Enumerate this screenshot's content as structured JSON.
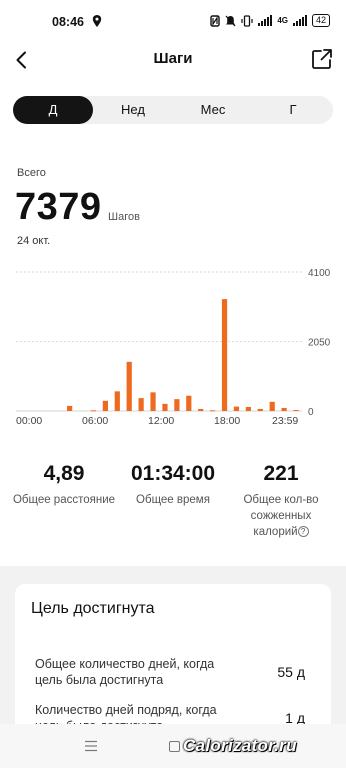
{
  "status": {
    "time": "08:46",
    "battery": "42",
    "network": "4G"
  },
  "header": {
    "title": "Шаги"
  },
  "tabs": [
    {
      "label": "Д",
      "active": true
    },
    {
      "label": "Нед",
      "active": false
    },
    {
      "label": "Мес",
      "active": false
    },
    {
      "label": "Г",
      "active": false
    }
  ],
  "summary": {
    "label": "Всего",
    "value": "7379",
    "unit": "Шагов",
    "date": "24 окт."
  },
  "chart_data": {
    "type": "bar",
    "color": "#ee6a1f",
    "x_tick_labels": [
      "00:00",
      "06:00",
      "12:00",
      "18:00",
      "23:59"
    ],
    "y_tick_labels": [
      "4100",
      "2050",
      "0"
    ],
    "ylim": [
      0,
      4100
    ],
    "bars": [
      {
        "hour": 4.5,
        "value": 150
      },
      {
        "hour": 6.5,
        "value": 20
      },
      {
        "hour": 7.5,
        "value": 300
      },
      {
        "hour": 8.5,
        "value": 580
      },
      {
        "hour": 9.5,
        "value": 1450
      },
      {
        "hour": 10.5,
        "value": 380
      },
      {
        "hour": 11.5,
        "value": 550
      },
      {
        "hour": 12.5,
        "value": 210
      },
      {
        "hour": 13.5,
        "value": 350
      },
      {
        "hour": 14.5,
        "value": 450
      },
      {
        "hour": 15.5,
        "value": 60
      },
      {
        "hour": 16.5,
        "value": 20
      },
      {
        "hour": 17.5,
        "value": 3300
      },
      {
        "hour": 18.5,
        "value": 130
      },
      {
        "hour": 19.5,
        "value": 120
      },
      {
        "hour": 20.5,
        "value": 60
      },
      {
        "hour": 21.5,
        "value": 270
      },
      {
        "hour": 22.5,
        "value": 90
      },
      {
        "hour": 23.5,
        "value": 30
      }
    ]
  },
  "stats": [
    {
      "value": "4,89",
      "label": "Общее расстояние"
    },
    {
      "value": "01:34:00",
      "label": "Общее время"
    },
    {
      "value": "221",
      "label_line1": "Общее кол-во",
      "label_line2": "сожженных",
      "label_line3": "калорий"
    }
  ],
  "goal": {
    "title": "Цель достигнута",
    "rows": [
      {
        "line1": "Общее количество дней, когда",
        "line2": "цель была достигнута",
        "value": "55 д"
      },
      {
        "line1": "Количество дней подряд, когда",
        "line2": "цель была достигнута",
        "value": "1 д"
      }
    ]
  },
  "watermark": "Calorizator.ru"
}
